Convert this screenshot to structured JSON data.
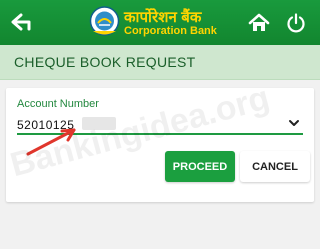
{
  "header": {
    "brand_hindi": "कार्पोरेशन बैंक",
    "brand_english": "Corporation Bank",
    "colors": {
      "bar": "#199a3d",
      "brand_text": "#ffd400"
    },
    "icons": {
      "back": "back-arrow-icon",
      "home": "home-icon",
      "power": "power-icon",
      "logo": "bank-logo-icon"
    }
  },
  "section": {
    "title": "CHEQUE BOOK REQUEST",
    "bg_color": "#cfe7cf"
  },
  "form": {
    "account_label": "Account Number",
    "account_value": "52010125",
    "dropdown_icon": "chevron-down-icon"
  },
  "actions": {
    "proceed_label": "PROCEED",
    "cancel_label": "CANCEL",
    "proceed_color": "#1b9f3f"
  },
  "overlay": {
    "watermark": "Bankingidea.org",
    "annotation_arrow_color": "#e0362c"
  }
}
